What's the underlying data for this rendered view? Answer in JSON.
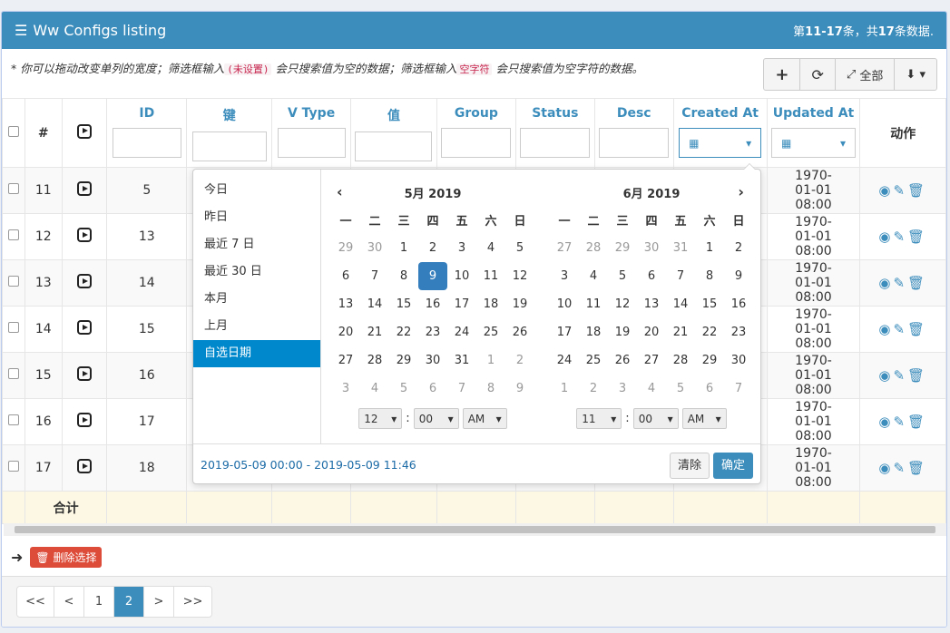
{
  "header": {
    "title": "Ww Configs listing",
    "summary_prefix": "第",
    "summary_range": "11-17",
    "summary_mid": "条，共",
    "summary_total": "17",
    "summary_suffix": "条数据."
  },
  "hint": {
    "part1": "* 你可以拖动改变单列的宽度；筛选框输入",
    "code1": "(未设置)",
    "part2": " 会只搜索值为空的数据；筛选框输入",
    "code2": "空字符",
    "part3": " 会只搜索值为空字符的数据。"
  },
  "toolbar": {
    "add": "+",
    "refresh": "⟳",
    "fullscreen_label": "全部",
    "export": "⬇"
  },
  "columns": [
    "#",
    "ID",
    "键",
    "V Type",
    "值",
    "Group",
    "Status",
    "Desc",
    "Created At",
    "Updated At",
    "动作"
  ],
  "rows": [
    {
      "no": "11",
      "id": "5",
      "updated": "1970-01-01 08:00"
    },
    {
      "no": "12",
      "id": "13",
      "updated": "1970-01-01 08:00"
    },
    {
      "no": "13",
      "id": "14",
      "updated": "1970-01-01 08:00"
    },
    {
      "no": "14",
      "id": "15",
      "updated": "1970-01-01 08:00"
    },
    {
      "no": "15",
      "id": "16",
      "updated": "1970-01-01 08:00"
    },
    {
      "no": "16",
      "id": "17",
      "updated": "1970-01-01 08:00"
    },
    {
      "no": "17",
      "id": "18",
      "updated": "1970-01-01 08:00"
    }
  ],
  "sum_label": "合计",
  "delete_selected": "删除选择",
  "pagination": [
    "<<",
    "<",
    "1",
    "2",
    ">",
    ">>"
  ],
  "picker": {
    "ranges": [
      "今日",
      "昨日",
      "最近 7 日",
      "最近 30 日",
      "本月",
      "上月",
      "自选日期"
    ],
    "left_title": "5月 2019",
    "right_title": "6月 2019",
    "dow": [
      "一",
      "二",
      "三",
      "四",
      "五",
      "六",
      "日"
    ],
    "left_days": [
      "29",
      "30",
      "1",
      "2",
      "3",
      "4",
      "5",
      "6",
      "7",
      "8",
      "9",
      "10",
      "11",
      "12",
      "13",
      "14",
      "15",
      "16",
      "17",
      "18",
      "19",
      "20",
      "21",
      "22",
      "23",
      "24",
      "25",
      "26",
      "27",
      "28",
      "29",
      "30",
      "31",
      "1",
      "2",
      "3",
      "4",
      "5",
      "6",
      "7",
      "8",
      "9"
    ],
    "right_days": [
      "27",
      "28",
      "29",
      "30",
      "31",
      "1",
      "2",
      "3",
      "4",
      "5",
      "6",
      "7",
      "8",
      "9",
      "10",
      "11",
      "12",
      "13",
      "14",
      "15",
      "16",
      "17",
      "18",
      "19",
      "20",
      "21",
      "22",
      "23",
      "24",
      "25",
      "26",
      "27",
      "28",
      "29",
      "30",
      "1",
      "2",
      "3",
      "4",
      "5",
      "6",
      "7"
    ],
    "left_time": {
      "hour": "12",
      "min": "00",
      "ampm": "AM"
    },
    "right_time": {
      "hour": "11",
      "min": "00",
      "ampm": "AM"
    },
    "range_text": "2019-05-09 00:00 - 2019-05-09 11:46",
    "clear": "清除",
    "apply": "确定"
  }
}
